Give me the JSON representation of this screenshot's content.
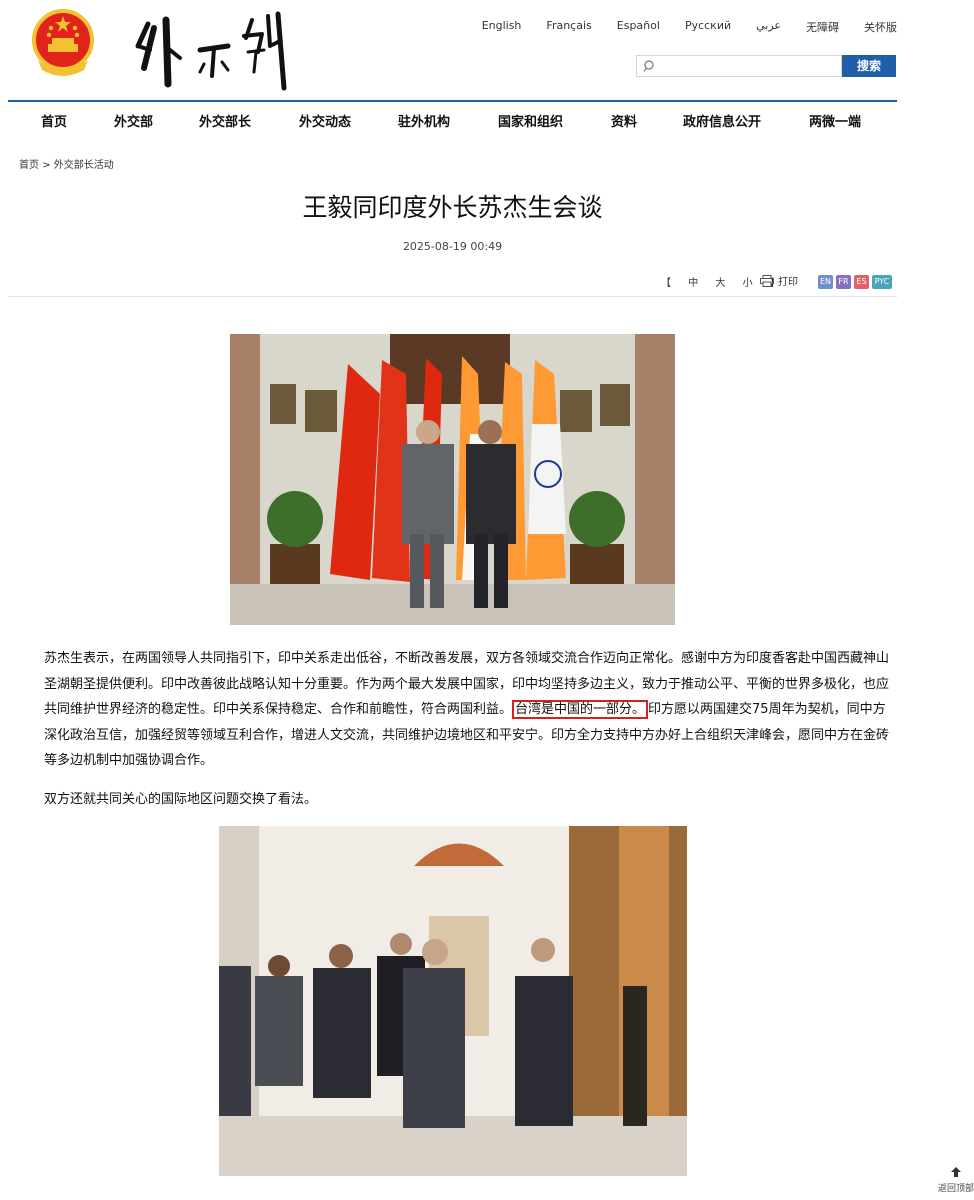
{
  "header": {
    "languages": [
      "English",
      "Français",
      "Español",
      "Русский",
      "عربي",
      "无障碍",
      "关怀版"
    ],
    "search": {
      "placeholder": "",
      "button": "搜索"
    }
  },
  "nav": [
    "首页",
    "外交部",
    "外交部长",
    "外交动态",
    "驻外机构",
    "国家和组织",
    "资料",
    "政府信息公开",
    "两微一端"
  ],
  "breadcrumb": {
    "home": "首页",
    "sep": ">",
    "section": "外交部长活动"
  },
  "article": {
    "title": "王毅同印度外长苏杰生会谈",
    "date": "2025-08-19 00:49",
    "font_size": {
      "open": "【",
      "large": "中",
      "medium": "大",
      "small": "小",
      "close": "】"
    },
    "print": "打印",
    "lang_buttons": [
      {
        "label": "EN",
        "color": "#6f8fc9"
      },
      {
        "label": "FR",
        "color": "#8a6fc0"
      },
      {
        "label": "ES",
        "color": "#e0626a"
      },
      {
        "label": "PYC",
        "color": "#49a4b8"
      }
    ],
    "paragraph1": {
      "before": "苏杰生表示，在两国领导人共同指引下，印中关系走出低谷，不断改善发展，双方各领域交流合作迈向正常化。感谢中方为印度香客赴中国西藏神山圣湖朝圣提供便利。印中改善彼此战略认知十分重要。作为两个最大发展中国家，印中均坚持多边主义，致力于推动公平、平衡的世界多极化，也应共同维护世界经济的稳定性。印中关系保持稳定、合作和前瞻性，符合两国利益。",
      "highlight": "台湾是中国的一部分。",
      "after": "印方愿以两国建交75周年为契机，同中方深化政治互信，加强经贸等领域互利合作，增进人文交流，共同维护边境地区和平安宁。印方全力支持中方办好上合组织天津峰会，愿同中方在金砖等多边机制中加强协调合作。"
    },
    "paragraph2": "双方还就共同关心的国际地区问题交换了看法。"
  },
  "footer": {
    "back_to_top": "返回顶部"
  }
}
